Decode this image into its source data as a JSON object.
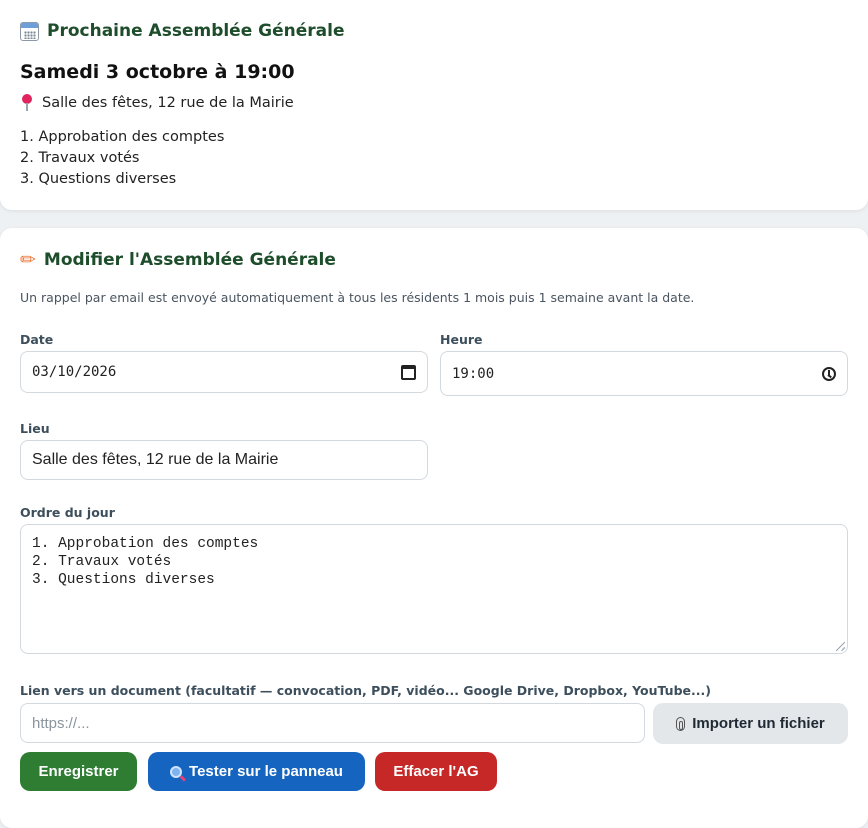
{
  "next_meeting": {
    "title": "Prochaine Assemblée Générale",
    "datetime": "Samedi 3 octobre à 19:00",
    "place": "Salle des fêtes, 12 rue de la Mairie",
    "agenda": [
      "1. Approbation des comptes",
      "2. Travaux votés",
      "3. Questions diverses"
    ]
  },
  "edit_form": {
    "title": "Modifier l'Assemblée Générale",
    "hint": "Un rappel par email est envoyé automatiquement à tous les résidents 1 mois puis 1 semaine avant la date.",
    "date": {
      "label": "Date",
      "value": "03/10/2026"
    },
    "time": {
      "label": "Heure",
      "value": "19:00"
    },
    "place": {
      "label": "Lieu",
      "value": "Salle des fêtes, 12 rue de la Mairie"
    },
    "agenda": {
      "label": "Ordre du jour",
      "lines": [
        "1. Approbation des comptes",
        "2. Travaux votés",
        "3. Questions diverses"
      ]
    },
    "document": {
      "label": "Lien vers un document (facultatif — convocation, PDF, vidéo... Google Drive, Dropbox, YouTube...)",
      "placeholder": "https://...",
      "import_label": "Importer un fichier"
    },
    "buttons": {
      "save": "Enregistrer",
      "test": "Tester sur le panneau",
      "clear": "Effacer l'AG"
    }
  },
  "colors": {
    "title_green": "#1e4d2b",
    "save": "#2e7d32",
    "test": "#1565c0",
    "clear": "#c62828"
  }
}
